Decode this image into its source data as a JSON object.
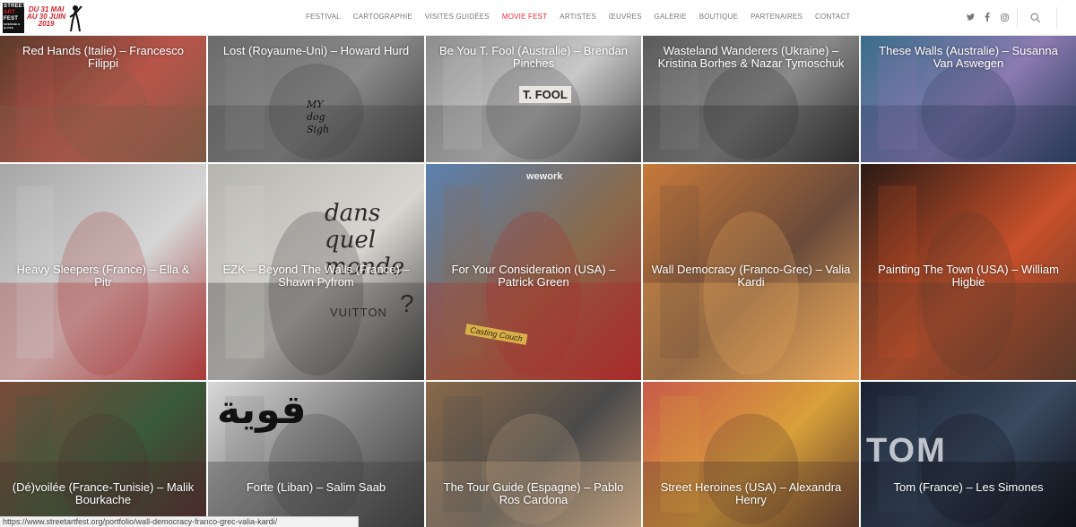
{
  "header": {
    "logo": {
      "line1": "STREET",
      "line2": "ART",
      "line3": "FEST",
      "line4": "GRENOBLE ALPES",
      "dates_line1": "DU 31 MAI",
      "dates_line2": "AU 30 JUIN",
      "year": "2019"
    },
    "nav": [
      {
        "label": "FESTIVAL",
        "active": false
      },
      {
        "label": "CARTOGRAPHIE",
        "active": false
      },
      {
        "label": "VISITES GUIDÉES",
        "active": false
      },
      {
        "label": "MOVIE FEST",
        "active": true
      },
      {
        "label": "ARTISTES",
        "active": false
      },
      {
        "label": "ŒUVRES",
        "active": false
      },
      {
        "label": "GALERIE",
        "active": false
      },
      {
        "label": "BOUTIQUE",
        "active": false
      },
      {
        "label": "PARTENAIRES",
        "active": false
      },
      {
        "label": "CONTACT",
        "active": false
      }
    ],
    "social_icons": [
      "twitter-icon",
      "facebook-icon",
      "instagram-icon"
    ],
    "search_icon": "search-icon",
    "accent_color": "#e8253b"
  },
  "films": [
    {
      "title": "Red Hands (Italie) – Francesco Filippi",
      "colors": [
        "#5a3a2a",
        "#b8554a",
        "#7e5a44"
      ]
    },
    {
      "title": "Lost (Royaume-Uni) – Howard Hurd",
      "colors": [
        "#6b6b6b",
        "#8a8a8a",
        "#3e3e3e"
      ]
    },
    {
      "title": "Be You T. Fool (Australie) – Brendan Pinches",
      "colors": [
        "#8c8c8c",
        "#c8c8c8",
        "#4a4a4a"
      ]
    },
    {
      "title": "Wasteland Wanderers (Ukraine) – Kristina Borhes & Nazar Tymoschuk",
      "colors": [
        "#5a5a5a",
        "#8a8a8a",
        "#2e2e2e"
      ]
    },
    {
      "title": "These Walls (Australie) – Susanna Van Aswegen",
      "colors": [
        "#3a6e8a",
        "#8a7ab0",
        "#2a3a5a"
      ]
    },
    {
      "title": "Heavy Sleepers (France) – Ella & Pitr",
      "colors": [
        "#a6a6a6",
        "#d5d5d5",
        "#a83a3a"
      ]
    },
    {
      "title": "EZK – Beyond The Walls (France) – Shawn Pyfrom",
      "colors": [
        "#b6b4ae",
        "#d7d5cf",
        "#3a3a3a"
      ]
    },
    {
      "title": "For Your Consideration (USA) – Patrick Green",
      "colors": [
        "#5a80b0",
        "#8a6a4a",
        "#a82a2a"
      ]
    },
    {
      "title": "Wall Democracy (Franco-Grec) – Valia Kardi",
      "colors": [
        "#c87a3a",
        "#6a4a3a",
        "#e8a85a"
      ]
    },
    {
      "title": "Painting The Town (USA) – William Higbie",
      "colors": [
        "#2a1a14",
        "#c8502a",
        "#5a3a2a"
      ]
    },
    {
      "title": "(Dé)voilée (France-Tunisie) – Malik Bourkache",
      "colors": [
        "#7a4a3a",
        "#3a5a3a",
        "#4a2a2a"
      ]
    },
    {
      "title": "Forte (Liban) – Salim Saab",
      "colors": [
        "#d8d8d8",
        "#7a7a7a",
        "#3a3a3a"
      ]
    },
    {
      "title": "The Tour Guide (Espagne) – Pablo Ros Cardona",
      "colors": [
        "#8a6a4a",
        "#4a4a4a",
        "#b89a7a"
      ]
    },
    {
      "title": "Street Heroines (USA) – Alexandra Henry",
      "colors": [
        "#c85a4a",
        "#d8a03a",
        "#5a3a2a"
      ]
    },
    {
      "title": "Tom (France) – Les Simones",
      "colors": [
        "#1a2030",
        "#3a4a60",
        "#0e1018"
      ]
    }
  ],
  "tile_texts": {
    "lost_graffiti": "MY dog Sigh",
    "tfool_sign": "T. FOOL",
    "ezk_text": "dans quel monde",
    "ezk_vuitton": "VUITTON",
    "ezk_question": "?",
    "patrick_building": "wework",
    "patrick_plaque": "Casting Couch",
    "forte_arabic": "قوية",
    "tom_letters": "TOM"
  },
  "status_url": "https://www.streetartfest.org/portfolio/wall-democracy-franco-grec-valia-kardi/"
}
